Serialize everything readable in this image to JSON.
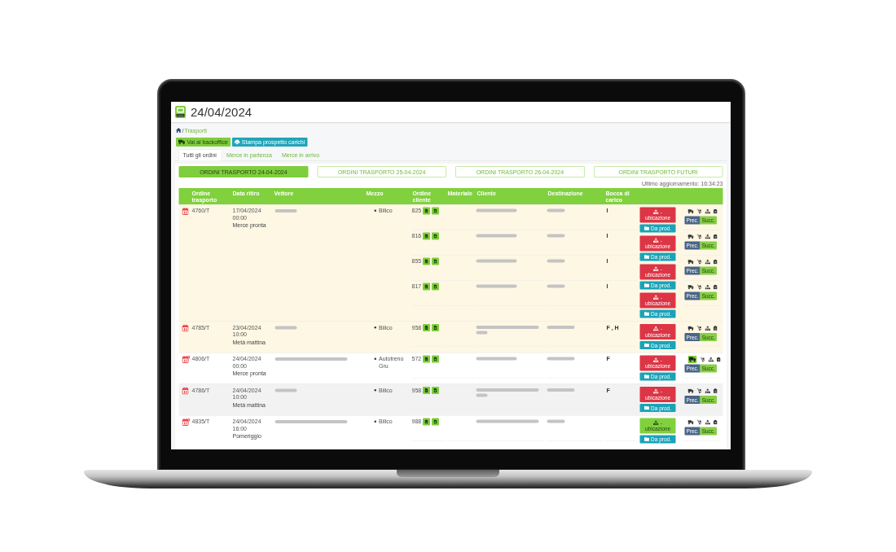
{
  "header": {
    "title": "24/04/2024"
  },
  "breadcrumb": {
    "separator": "/",
    "current": "Trasporti"
  },
  "actions": [
    {
      "kind": "backoffice",
      "label": "Vai al backoffice"
    },
    {
      "kind": "print",
      "label": "Stampa prospetto carichi"
    }
  ],
  "tabs": [
    {
      "label": "Tutti gli ordini",
      "selected": true
    },
    {
      "label": "Merce in partenza",
      "selected": false
    },
    {
      "label": "Merce in arrivo",
      "selected": false
    }
  ],
  "date_filters": [
    {
      "label": "ORDINI TRASPORTO 24-04-2024",
      "selected": true
    },
    {
      "label": "ORDINI TRASPORTO 25-04-2024",
      "selected": false
    },
    {
      "label": "ORDINI TRASPORTO 26-04-2024",
      "selected": false
    },
    {
      "label": "ORDINI TRASPORTO FUTURI",
      "selected": false
    }
  ],
  "last_update": "Ultimo aggiornamento: 16:34:23",
  "table": {
    "columns": [
      "Ordine trasporto",
      "Data ritiro",
      "Vettore",
      "Mezzo",
      "Ordine cliente",
      "Materiale",
      "Cliente",
      "Destinazione",
      "Bocca di carico"
    ],
    "rows": [
      {
        "order": "4760/T",
        "calendar_alert": false,
        "color": "#fdf7e4",
        "pickup_date": "17/04/2024",
        "pickup_time": "00:00",
        "pickup_note": "Merce pronta",
        "vettore_blurred": true,
        "vettore_long": false,
        "mezzo": [
          "Bilico"
        ],
        "client_orders": [
          {
            "number": "825",
            "cliente_blurred": true,
            "cliente_long": false,
            "cliente_wrapped": false,
            "destinazione_blurred": true,
            "destinazione_long": false,
            "bocca": "I",
            "ubicazione": {
              "label": "- ubicazione",
              "color": "#dc3545"
            },
            "production": "Da prod.",
            "truck_active": false,
            "prev": "Prec.",
            "next": "Succ."
          },
          {
            "number": "816",
            "cliente_blurred": true,
            "cliente_long": false,
            "cliente_wrapped": false,
            "destinazione_blurred": true,
            "destinazione_long": false,
            "bocca": "I",
            "ubicazione": {
              "label": "- ubicazione",
              "color": "#dc3545"
            },
            "production": "Da prod.",
            "truck_active": false,
            "prev": "Prec.",
            "next": "Succ."
          },
          {
            "number": "855",
            "cliente_blurred": true,
            "cliente_long": false,
            "cliente_wrapped": false,
            "destinazione_blurred": true,
            "destinazione_long": false,
            "bocca": "I",
            "ubicazione": {
              "label": "- ubicazione",
              "color": "#dc3545"
            },
            "production": "Da prod.",
            "truck_active": false,
            "prev": "Prec.",
            "next": "Succ."
          },
          {
            "number": "817",
            "cliente_blurred": true,
            "cliente_long": false,
            "cliente_wrapped": false,
            "destinazione_blurred": true,
            "destinazione_long": false,
            "bocca": "I",
            "ubicazione": {
              "label": "- ubicazione",
              "color": "#dc3545"
            },
            "production": "Da prod.",
            "truck_active": false,
            "prev": "Prec.",
            "next": "Succ."
          }
        ]
      },
      {
        "order": "4785/T",
        "calendar_alert": false,
        "color": "#fdf7e4",
        "pickup_date": "23/04/2024",
        "pickup_time": "10:00",
        "pickup_note": "Metà mattina",
        "vettore_blurred": true,
        "vettore_long": false,
        "mezzo": [
          "Bilico"
        ],
        "client_orders": [
          {
            "number": "958",
            "cliente_blurred": true,
            "cliente_long": true,
            "cliente_wrapped": true,
            "destinazione_blurred": true,
            "destinazione_long": true,
            "bocca": "F , H",
            "ubicazione": {
              "label": "- ubicazione",
              "color": "#dc3545"
            },
            "production": "Da prod.",
            "truck_active": false,
            "prev": "Prec.",
            "next": "Succ."
          }
        ]
      },
      {
        "order": "4806/T",
        "calendar_alert": true,
        "color": "#ffffff",
        "pickup_date": "24/04/2024",
        "pickup_time": "00:00",
        "pickup_note": "Merce pronta",
        "vettore_blurred": true,
        "vettore_long": true,
        "mezzo": [
          "Autotreno Gru"
        ],
        "client_orders": [
          {
            "number": "572",
            "cliente_blurred": true,
            "cliente_long": false,
            "cliente_wrapped": false,
            "destinazione_blurred": true,
            "destinazione_long": true,
            "bocca": "F",
            "ubicazione": {
              "label": "- ubicazione",
              "color": "#dc3545"
            },
            "production": "Da prod.",
            "truck_active": true,
            "prev": "Prec.",
            "next": "Succ."
          }
        ]
      },
      {
        "order": "4786/T",
        "calendar_alert": false,
        "color": "#f2f2f2",
        "pickup_date": "24/04/2024",
        "pickup_time": "10:00",
        "pickup_note": "Metà mattina",
        "vettore_blurred": true,
        "vettore_long": false,
        "mezzo": [
          "Bilico"
        ],
        "client_orders": [
          {
            "number": "958",
            "cliente_blurred": true,
            "cliente_long": true,
            "cliente_wrapped": true,
            "destinazione_blurred": true,
            "destinazione_long": true,
            "bocca": "F",
            "ubicazione": {
              "label": "- ubicazione",
              "color": "#dc3545"
            },
            "production": "Da prod.",
            "truck_active": false,
            "prev": "Prec.",
            "next": "Succ."
          }
        ]
      },
      {
        "order": "4835/T",
        "calendar_alert": true,
        "color": "#ffffff",
        "pickup_date": "24/04/2024",
        "pickup_time": "16:00",
        "pickup_note": "Pomeriggio",
        "vettore_blurred": true,
        "vettore_long": true,
        "mezzo": [
          "Bilico"
        ],
        "client_orders": [
          {
            "number": "988",
            "cliente_blurred": true,
            "cliente_long": true,
            "cliente_wrapped": false,
            "destinazione_blurred": true,
            "destinazione_long": false,
            "ubicazione": {
              "label": "- ubicazione",
              "color": "#80d13d"
            },
            "production": "Da prod.",
            "truck_active": false,
            "prev": "Prec.",
            "next": "Succ."
          }
        ]
      }
    ]
  }
}
